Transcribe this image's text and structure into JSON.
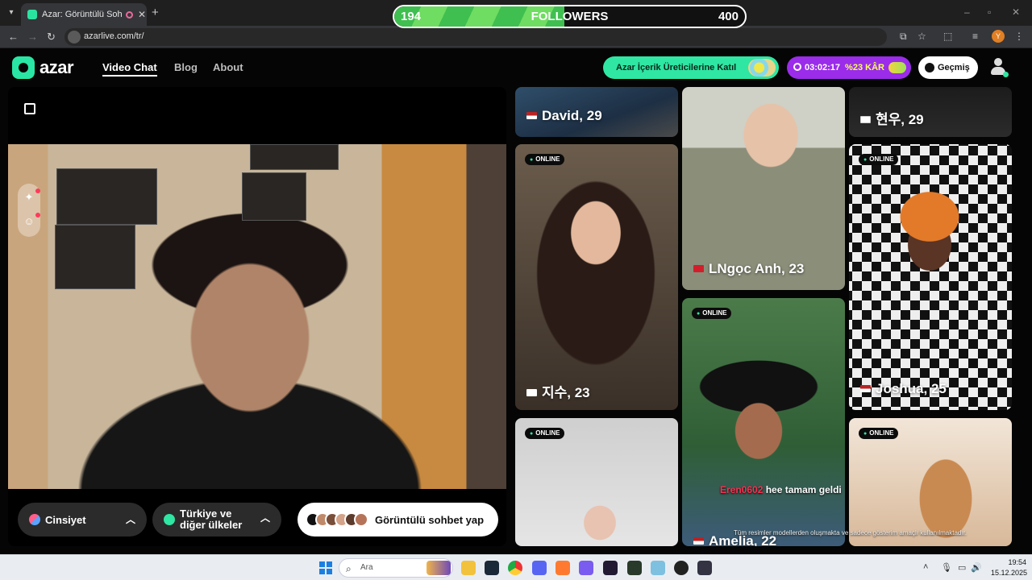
{
  "browser": {
    "tab_title": "Azar: Görüntülü Sohbet, Yeni",
    "url": "azarlive.com/tr/",
    "profile_initial": "Y"
  },
  "overlay": {
    "followers_current": "194",
    "followers_label": "FOLLOWERS",
    "followers_goal": "400",
    "progress_fraction": 0.485
  },
  "site": {
    "logo": "azar",
    "nav": [
      "Video Chat",
      "Blog",
      "About"
    ],
    "creator_button": "Azar İçerik Üreticilerine Katıl",
    "timer": "03:02:17",
    "bonus": "%23 KÂR",
    "history_button": "Geçmiş",
    "accent": "#2fe6a3"
  },
  "controls": {
    "gender": "Cinsiyet",
    "country_line1": "Türkiye ve",
    "country_line2": "diğer ülkeler",
    "start": "Görüntülü sohbet yap"
  },
  "profiles": [
    {
      "name": "David, 29",
      "online": ""
    },
    {
      "name": "LNgọc Anh, 23",
      "online": ""
    },
    {
      "name": "현우, 29",
      "online": ""
    },
    {
      "name": "지수, 23",
      "online": "ONLINE"
    },
    {
      "name": "Joshua, 25",
      "online": "ONLINE"
    },
    {
      "name": "Amelia, 22",
      "online": "ONLINE"
    },
    {
      "name": "",
      "online": "ONLINE"
    },
    {
      "name": "",
      "online": "ONLINE"
    }
  ],
  "chat": {
    "user": "Eren0602",
    "message": "hee tamam geldi"
  },
  "disclaimer": "Tüm resimler modellerden oluşmakta ve sadece gösterim amaçlı kullanılmaktadır.",
  "taskbar": {
    "search_placeholder": "Ara",
    "time": "19:54",
    "date": "15.12.2025"
  }
}
